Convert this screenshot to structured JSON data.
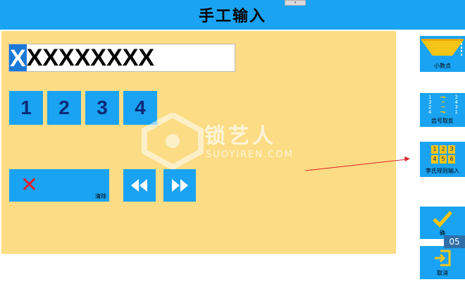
{
  "header": {
    "title": "手工输入"
  },
  "input": {
    "cursor_char": "X",
    "rest": "XXXXXXXX"
  },
  "keypad": [
    {
      "label": "1"
    },
    {
      "label": "2"
    },
    {
      "label": "3"
    },
    {
      "label": "4"
    }
  ],
  "clear_button": {
    "label": "清除"
  },
  "side_buttons": {
    "decimal": {
      "label": "小数点"
    },
    "reverse": {
      "label": "齿号取反"
    },
    "rule_input": {
      "label": "李氏规则输入",
      "grid": [
        "1",
        "2",
        "3",
        "4",
        "5",
        "6"
      ]
    },
    "confirm": {
      "label": "确"
    },
    "cancel": {
      "label": "取消"
    }
  },
  "reverse_icon_digits": [
    "1",
    "2",
    "3",
    "4",
    "2",
    "3",
    "4",
    "1"
  ],
  "watermark": {
    "main": "锁艺人",
    "sub": "SUOYIREN.COM"
  },
  "time_badge": "05",
  "colors": {
    "header": "#1aa3f2",
    "panel": "#fcdc84",
    "button": "#1aa3f2",
    "clear_x": "#e0202b",
    "arrow": "#e0202b"
  }
}
